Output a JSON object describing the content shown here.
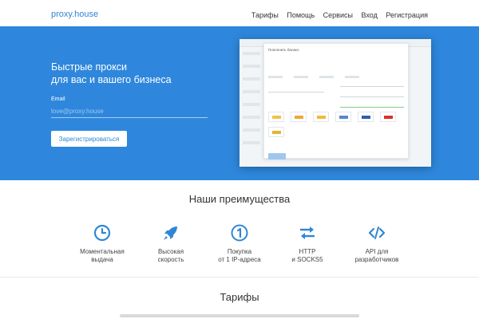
{
  "nav": {
    "logo": "proxy.house",
    "items": [
      "Тарифы",
      "Помощь",
      "Сервисы",
      "Вход",
      "Регистрация"
    ]
  },
  "hero": {
    "title_line1": "Быстрые прокси",
    "title_line2": "для вас и вашего бизнеса",
    "email_label": "Email",
    "email_placeholder": "love@proxy.house",
    "register_button": "Зарегистрироваться",
    "mockup": {
      "modal_title": "Пополнить баланс"
    }
  },
  "advantages": {
    "title": "Наши преимущества",
    "items": [
      {
        "line1": "Моментальная",
        "line2": "выдача",
        "icon": "clock-icon"
      },
      {
        "line1": "Высокая",
        "line2": "скорость",
        "icon": "rocket-icon"
      },
      {
        "line1": "Покупка",
        "line2": "от 1 IP-адреса",
        "icon": "one-circle-icon"
      },
      {
        "line1": "HTTP",
        "line2": "и SOCKS5",
        "icon": "swap-arrows-icon"
      },
      {
        "line1": "API для",
        "line2": "разработчиков",
        "icon": "code-icon"
      }
    ]
  },
  "tariffs": {
    "title": "Тарифы"
  },
  "colors": {
    "accent": "#2e87dc",
    "link": "#2f86d6",
    "icon": "#2f86d6"
  }
}
